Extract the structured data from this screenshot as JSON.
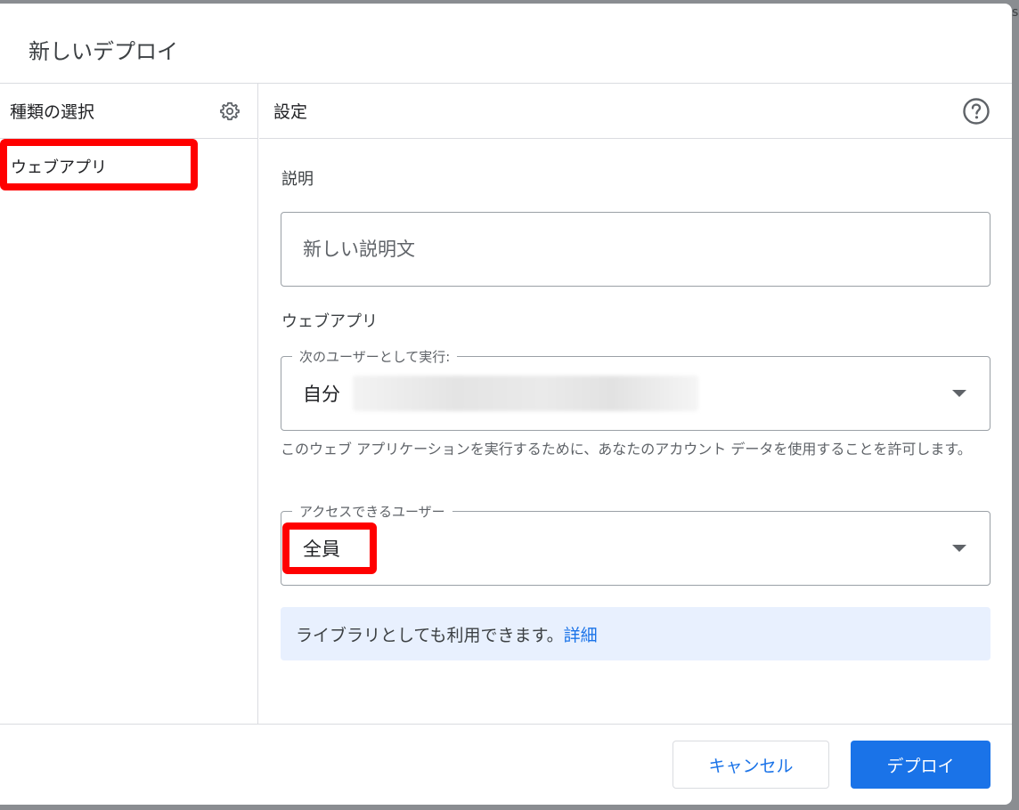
{
  "dialog": {
    "title": "新しいデプロイ"
  },
  "left_pane": {
    "title": "種類の選択",
    "settings_icon": "gear-icon",
    "types": [
      {
        "label": "ウェブアプリ"
      }
    ]
  },
  "right_pane": {
    "title": "設定",
    "help_icon": "help-circle-icon",
    "description": {
      "label": "説明",
      "placeholder": "新しい説明文",
      "value": ""
    },
    "web_app": {
      "section_label": "ウェブアプリ",
      "execute_as": {
        "label": "次のユーザーとして実行:",
        "value": "自分"
      },
      "helper_text": "このウェブ アプリケーションを実行するために、あなたのアカウント データを使用することを許可します。",
      "access": {
        "label": "アクセスできるユーザー",
        "value": "全員"
      }
    },
    "library_notice": {
      "text": "ライブラリとしても利用できます。",
      "link_label": "詳細"
    }
  },
  "footer": {
    "cancel_label": "キャンセル",
    "deploy_label": "デプロイ"
  },
  "colors": {
    "primary": "#1a73e8",
    "highlight": "#ff0000",
    "banner_bg": "#e8f0fe",
    "divider": "#dadce0"
  }
}
